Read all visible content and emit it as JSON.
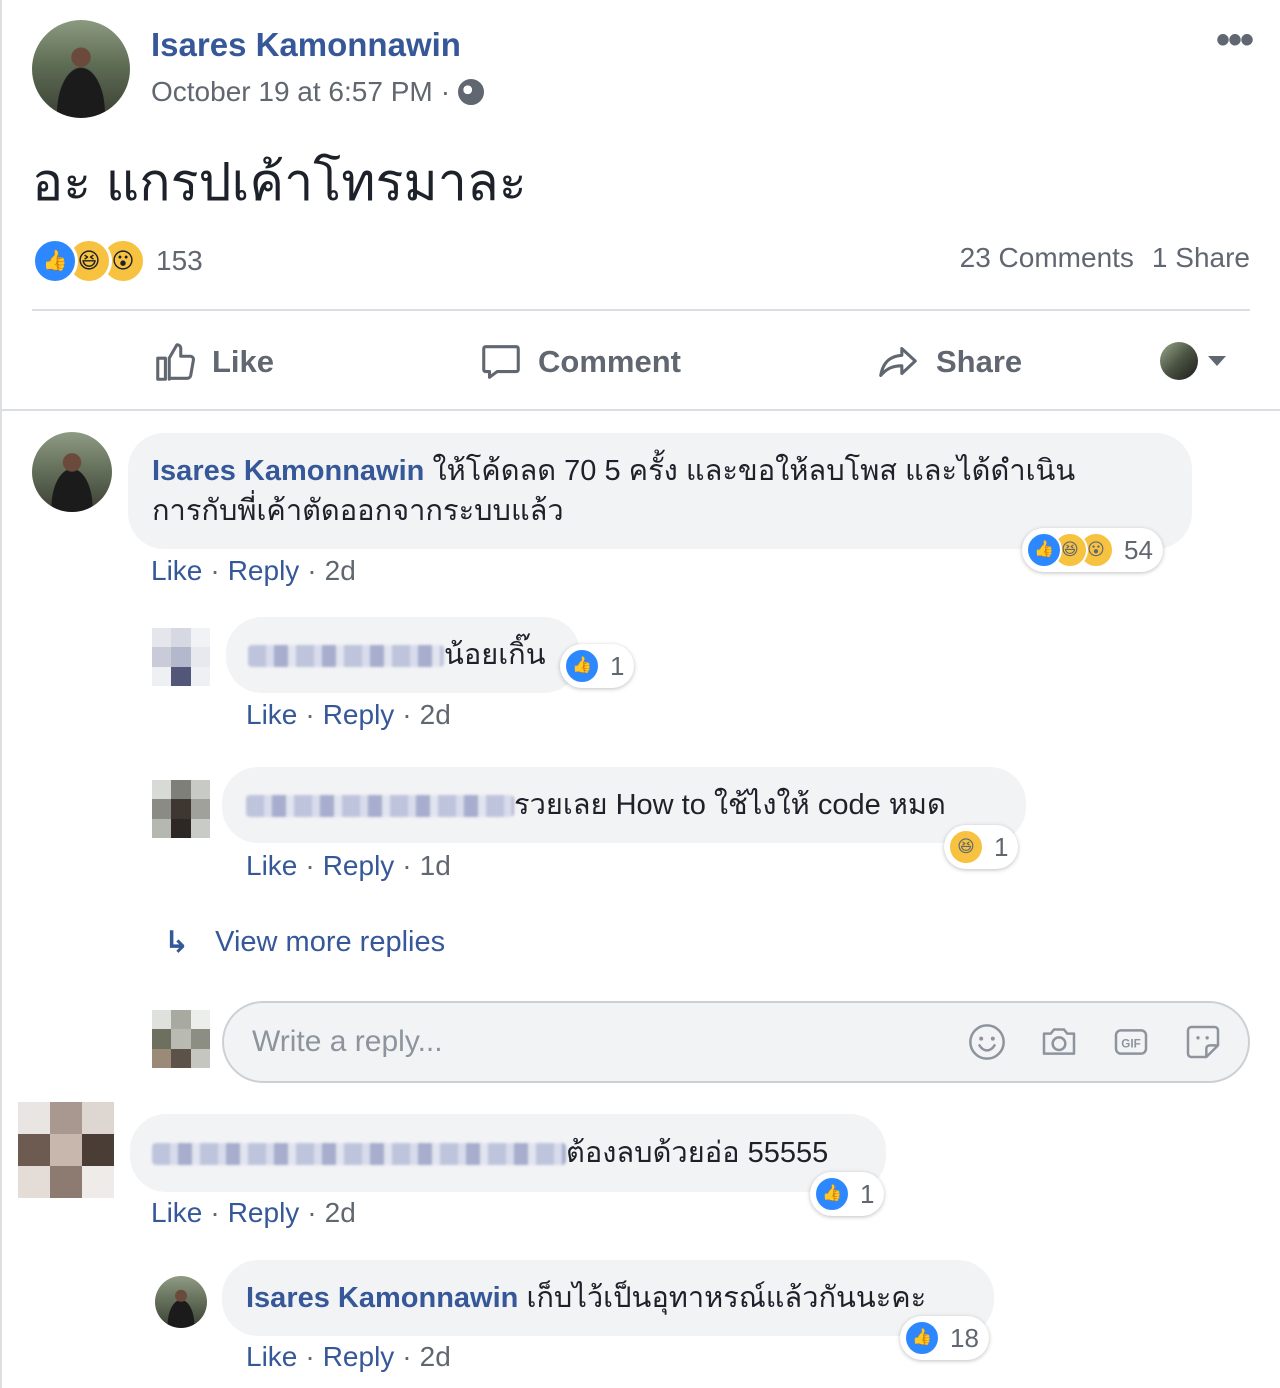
{
  "post": {
    "author": "Isares Kamonnawin",
    "timestamp": "October 19 at 6:57 PM",
    "separator": "·",
    "text": "อะ แกรปเค้าโทรมาละ",
    "reactions_count": "153",
    "comments_count": "23 Comments",
    "shares_count": "1 Share",
    "privacy_icon": "globe-icon"
  },
  "actions": {
    "like": "Like",
    "comment": "Comment",
    "share": "Share"
  },
  "comments": [
    {
      "author": "Isares Kamonnawin",
      "text_line1": "ให้โค้ดลด 70 5 ครั้ง และขอให้ลบโพส และได้ดำเนิน",
      "text_line2": "การกับพี่เค้าตัดออกจากระบบแล้ว",
      "like": "Like",
      "reply": "Reply",
      "age": "2d",
      "reactions": "54"
    },
    {
      "author": "",
      "text": "น้อยเกิ๊น",
      "like": "Like",
      "reply": "Reply",
      "age": "2d",
      "reactions": "1"
    },
    {
      "author": "",
      "text": "รวยเลย How to ใช้ไงให้ code หมด",
      "like": "Like",
      "reply": "Reply",
      "age": "1d",
      "reactions": "1"
    },
    {
      "author": "",
      "text": "ต้องลบด้วยอ่อ 55555",
      "like": "Like",
      "reply": "Reply",
      "age": "2d",
      "reactions": "1"
    },
    {
      "author": "Isares Kamonnawin",
      "text": "เก็บไว้เป็นอุทาหรณ์แล้วกันนะคะ",
      "like": "Like",
      "reply": "Reply",
      "age": "2d",
      "reactions": "18"
    }
  ],
  "view_more_replies": "View more replies",
  "reply_box": {
    "placeholder": "Write a reply...",
    "tools": [
      "emoji-icon",
      "camera-icon",
      "gif-icon",
      "sticker-icon"
    ]
  },
  "colors": {
    "link": "#365899",
    "meta": "#616770",
    "bubble": "#f2f3f5",
    "like_blue": "#2d88ff",
    "emoji_yellow": "#f7c23f"
  }
}
